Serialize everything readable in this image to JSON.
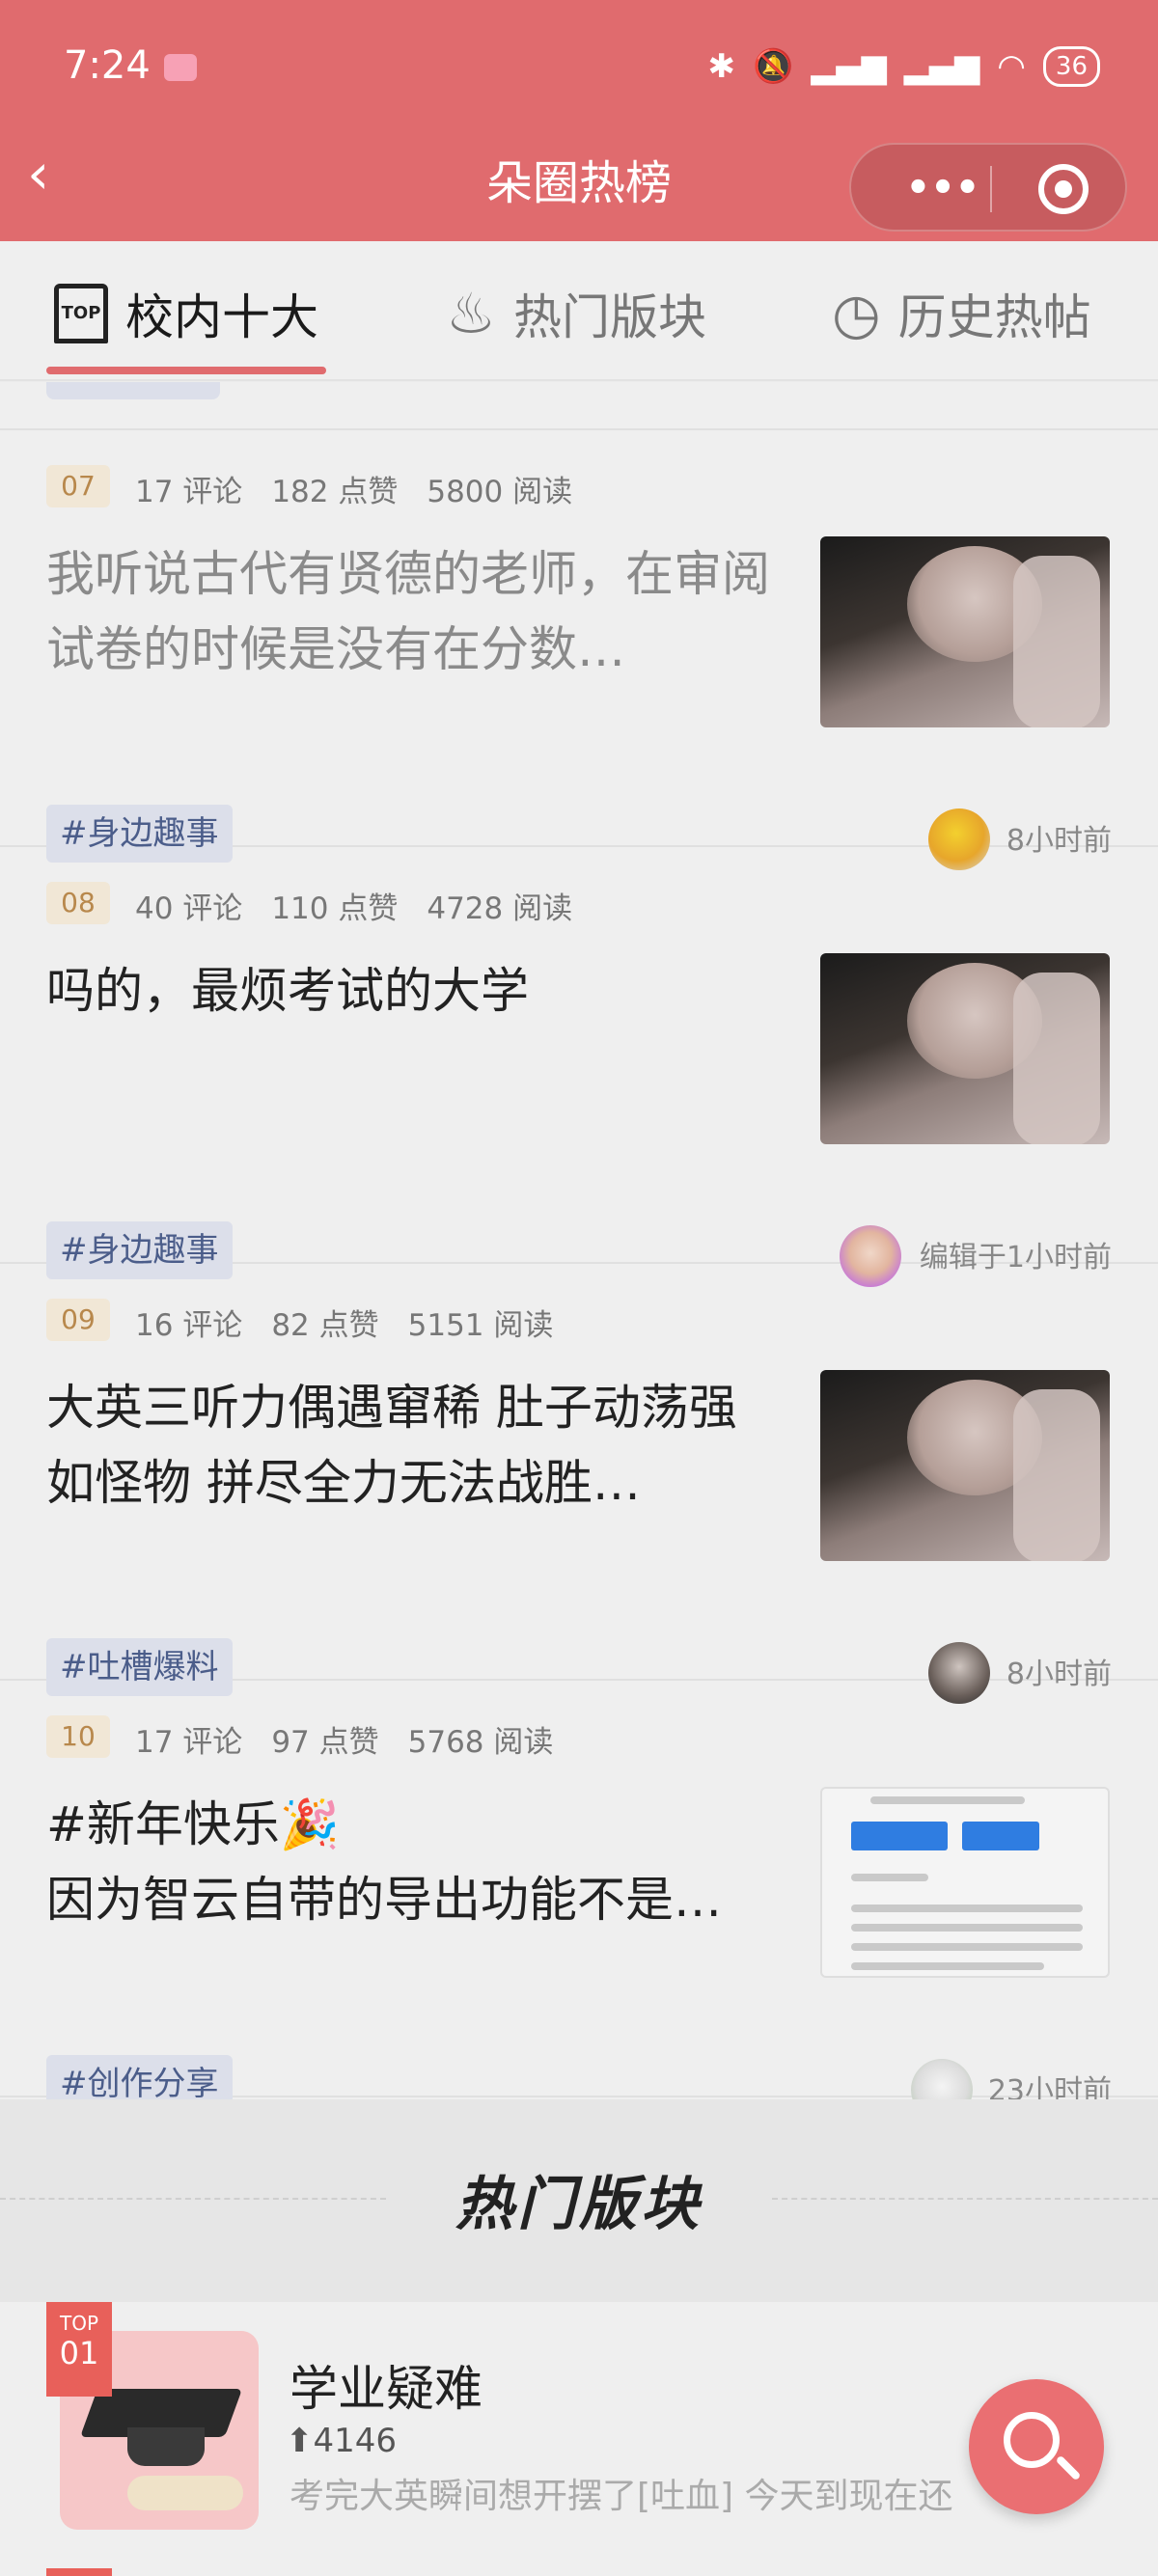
{
  "status_bar": {
    "time": "7:24",
    "battery": "36"
  },
  "nav": {
    "back": "‹",
    "title": "朵圈热榜",
    "menu": "•••"
  },
  "tabs": [
    {
      "label": "校内十大",
      "icon": "top-icon"
    },
    {
      "label": "热门版块",
      "icon": "flame-icon"
    },
    {
      "label": "历史热帖",
      "icon": "clock-icon"
    }
  ],
  "posts": [
    {
      "rank": "07",
      "comments": "17 评论",
      "likes": "182 点赞",
      "reads": "5800 阅读",
      "title": "我听说古代有贤德的老师，在审阅试卷的时候是没有在分数…",
      "tag": "#身边趣事",
      "time": "8小时前"
    },
    {
      "rank": "08",
      "comments": "40 评论",
      "likes": "110 点赞",
      "reads": "4728 阅读",
      "title": "吗的，最烦考试的大学",
      "tag": "#身边趣事",
      "time": "编辑于1小时前"
    },
    {
      "rank": "09",
      "comments": "16 评论",
      "likes": "82 点赞",
      "reads": "5151 阅读",
      "title": "大英三听力偶遇窜稀 肚子动荡强如怪物 拼尽全力无法战胜…",
      "tag": "#吐槽爆料",
      "time": "8小时前"
    },
    {
      "rank": "10",
      "comments": "17 评论",
      "likes": "97 点赞",
      "reads": "5768 阅读",
      "title_line1": "#新年快乐🎉",
      "title_line2": "因为智云自带的导出功能不是…",
      "tag": "#创作分享",
      "time": "23小时前"
    }
  ],
  "section": {
    "title": "热门版块"
  },
  "board": {
    "rank_top": "TOP",
    "rank_num": "01",
    "name": "学业疑难",
    "stat": "4146",
    "desc": "考完大英瞬间想开摆了[吐血] 今天到现在还"
  },
  "colors": {
    "brand": "#e06b6e",
    "tag_bg": "#dcdfea",
    "tag_text": "#4b5d8a",
    "rank_bg": "#f1e7d6",
    "rank_text": "#b8884c"
  }
}
